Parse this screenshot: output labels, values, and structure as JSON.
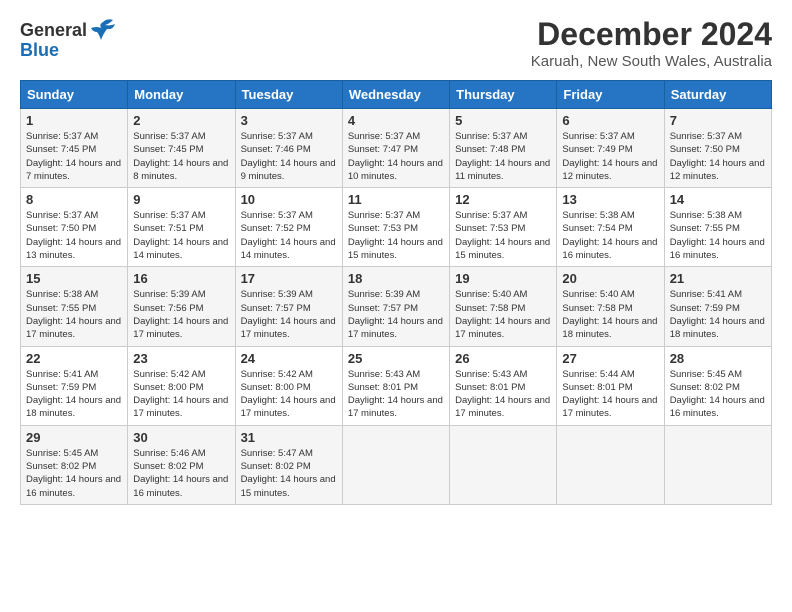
{
  "header": {
    "logo_line1": "General",
    "logo_line2": "Blue",
    "title": "December 2024",
    "subtitle": "Karuah, New South Wales, Australia"
  },
  "weekdays": [
    "Sunday",
    "Monday",
    "Tuesday",
    "Wednesday",
    "Thursday",
    "Friday",
    "Saturday"
  ],
  "weeks": [
    [
      {
        "day": "1",
        "sunrise": "5:37 AM",
        "sunset": "7:45 PM",
        "daylight": "14 hours and 7 minutes."
      },
      {
        "day": "2",
        "sunrise": "5:37 AM",
        "sunset": "7:45 PM",
        "daylight": "14 hours and 8 minutes."
      },
      {
        "day": "3",
        "sunrise": "5:37 AM",
        "sunset": "7:46 PM",
        "daylight": "14 hours and 9 minutes."
      },
      {
        "day": "4",
        "sunrise": "5:37 AM",
        "sunset": "7:47 PM",
        "daylight": "14 hours and 10 minutes."
      },
      {
        "day": "5",
        "sunrise": "5:37 AM",
        "sunset": "7:48 PM",
        "daylight": "14 hours and 11 minutes."
      },
      {
        "day": "6",
        "sunrise": "5:37 AM",
        "sunset": "7:49 PM",
        "daylight": "14 hours and 12 minutes."
      },
      {
        "day": "7",
        "sunrise": "5:37 AM",
        "sunset": "7:50 PM",
        "daylight": "14 hours and 12 minutes."
      }
    ],
    [
      {
        "day": "8",
        "sunrise": "5:37 AM",
        "sunset": "7:50 PM",
        "daylight": "14 hours and 13 minutes."
      },
      {
        "day": "9",
        "sunrise": "5:37 AM",
        "sunset": "7:51 PM",
        "daylight": "14 hours and 14 minutes."
      },
      {
        "day": "10",
        "sunrise": "5:37 AM",
        "sunset": "7:52 PM",
        "daylight": "14 hours and 14 minutes."
      },
      {
        "day": "11",
        "sunrise": "5:37 AM",
        "sunset": "7:53 PM",
        "daylight": "14 hours and 15 minutes."
      },
      {
        "day": "12",
        "sunrise": "5:37 AM",
        "sunset": "7:53 PM",
        "daylight": "14 hours and 15 minutes."
      },
      {
        "day": "13",
        "sunrise": "5:38 AM",
        "sunset": "7:54 PM",
        "daylight": "14 hours and 16 minutes."
      },
      {
        "day": "14",
        "sunrise": "5:38 AM",
        "sunset": "7:55 PM",
        "daylight": "14 hours and 16 minutes."
      }
    ],
    [
      {
        "day": "15",
        "sunrise": "5:38 AM",
        "sunset": "7:55 PM",
        "daylight": "14 hours and 17 minutes."
      },
      {
        "day": "16",
        "sunrise": "5:39 AM",
        "sunset": "7:56 PM",
        "daylight": "14 hours and 17 minutes."
      },
      {
        "day": "17",
        "sunrise": "5:39 AM",
        "sunset": "7:57 PM",
        "daylight": "14 hours and 17 minutes."
      },
      {
        "day": "18",
        "sunrise": "5:39 AM",
        "sunset": "7:57 PM",
        "daylight": "14 hours and 17 minutes."
      },
      {
        "day": "19",
        "sunrise": "5:40 AM",
        "sunset": "7:58 PM",
        "daylight": "14 hours and 17 minutes."
      },
      {
        "day": "20",
        "sunrise": "5:40 AM",
        "sunset": "7:58 PM",
        "daylight": "14 hours and 18 minutes."
      },
      {
        "day": "21",
        "sunrise": "5:41 AM",
        "sunset": "7:59 PM",
        "daylight": "14 hours and 18 minutes."
      }
    ],
    [
      {
        "day": "22",
        "sunrise": "5:41 AM",
        "sunset": "7:59 PM",
        "daylight": "14 hours and 18 minutes."
      },
      {
        "day": "23",
        "sunrise": "5:42 AM",
        "sunset": "8:00 PM",
        "daylight": "14 hours and 17 minutes."
      },
      {
        "day": "24",
        "sunrise": "5:42 AM",
        "sunset": "8:00 PM",
        "daylight": "14 hours and 17 minutes."
      },
      {
        "day": "25",
        "sunrise": "5:43 AM",
        "sunset": "8:01 PM",
        "daylight": "14 hours and 17 minutes."
      },
      {
        "day": "26",
        "sunrise": "5:43 AM",
        "sunset": "8:01 PM",
        "daylight": "14 hours and 17 minutes."
      },
      {
        "day": "27",
        "sunrise": "5:44 AM",
        "sunset": "8:01 PM",
        "daylight": "14 hours and 17 minutes."
      },
      {
        "day": "28",
        "sunrise": "5:45 AM",
        "sunset": "8:02 PM",
        "daylight": "14 hours and 16 minutes."
      }
    ],
    [
      {
        "day": "29",
        "sunrise": "5:45 AM",
        "sunset": "8:02 PM",
        "daylight": "14 hours and 16 minutes."
      },
      {
        "day": "30",
        "sunrise": "5:46 AM",
        "sunset": "8:02 PM",
        "daylight": "14 hours and 16 minutes."
      },
      {
        "day": "31",
        "sunrise": "5:47 AM",
        "sunset": "8:02 PM",
        "daylight": "14 hours and 15 minutes."
      },
      null,
      null,
      null,
      null
    ]
  ]
}
